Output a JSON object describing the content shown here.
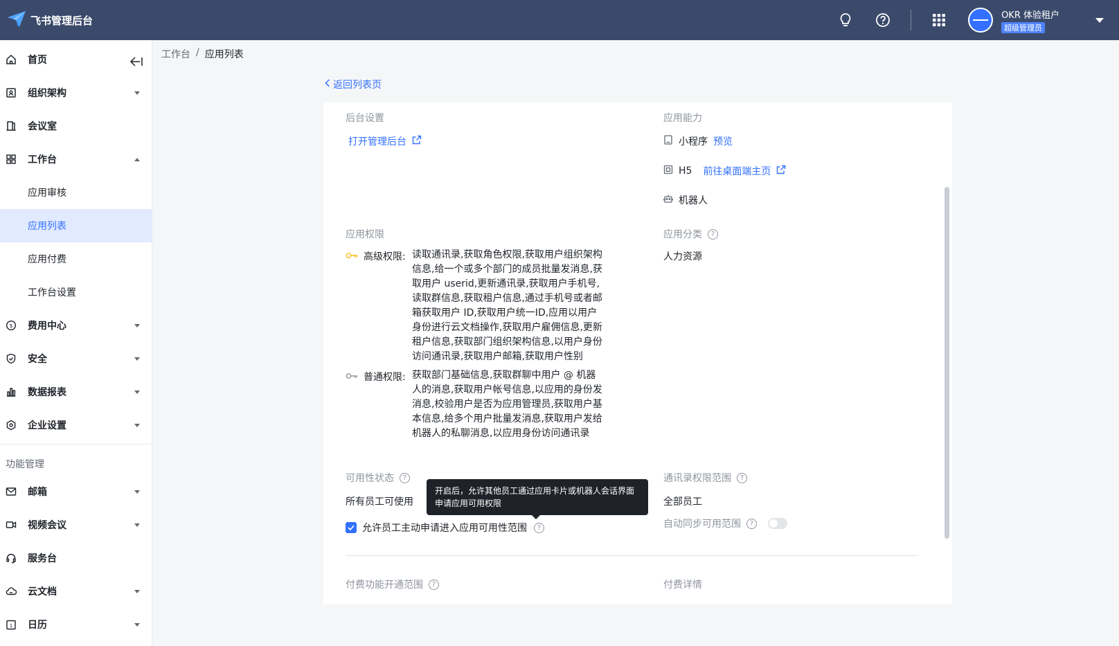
{
  "header": {
    "app_title": "飞书管理后台",
    "tenant_name": "OKR 体验租户",
    "role_badge": "超级管理员",
    "icons": [
      "bulb-icon",
      "help-icon",
      "apps-grid-icon"
    ]
  },
  "sidebar": {
    "items": [
      {
        "label": "首页",
        "icon": "home-icon"
      },
      {
        "label": "组织架构",
        "icon": "org-icon"
      },
      {
        "label": "会议室",
        "icon": "door-icon"
      },
      {
        "label": "工作台",
        "icon": "workbench-icon"
      },
      {
        "label": "费用中心",
        "icon": "coin-icon"
      },
      {
        "label": "安全",
        "icon": "shield-icon"
      },
      {
        "label": "数据报表",
        "icon": "chart-icon"
      },
      {
        "label": "企业设置",
        "icon": "settings-icon"
      },
      {
        "label": "邮箱",
        "icon": "mail-icon"
      },
      {
        "label": "视频会议",
        "icon": "video-icon"
      },
      {
        "label": "服务台",
        "icon": "headset-icon"
      },
      {
        "label": "云文档",
        "icon": "cloud-doc-icon"
      },
      {
        "label": "日历",
        "icon": "calendar-icon"
      }
    ],
    "sub_items": [
      {
        "label": "应用审核"
      },
      {
        "label": "应用列表",
        "active": true
      },
      {
        "label": "应用付费"
      },
      {
        "label": "工作台设置"
      }
    ],
    "group_label": "功能管理"
  },
  "breadcrumb": {
    "root": "工作台",
    "sep": "/",
    "current": "应用列表"
  },
  "back_link": "返回列表页",
  "backend": {
    "title": "后台设置",
    "open_link": "打开管理后台"
  },
  "capability": {
    "title": "应用能力",
    "mini_program": "小程序",
    "preview": "预览",
    "h5": "H5",
    "desktop_link": "前往桌面端主页",
    "bot": "机器人"
  },
  "permissions": {
    "title": "应用权限",
    "high_label": "高级权限:",
    "high_text": "读取通讯录,获取角色权限,获取用户组织架构信息,给一个或多个部门的成员批量发消息,获取用户 userid,更新通讯录,获取用户手机号,读取群信息,获取租户信息,通过手机号或者邮箱获取用户 ID,获取用户统一ID,应用以用户身份进行云文档操作,获取用户雇佣信息,更新租户信息,获取部门组织架构信息,以用户身份访问通讯录,获取用户邮箱,获取用户性别",
    "normal_label": "普通权限:",
    "normal_text": "获取部门基础信息,获取群聊中用户 @ 机器人的消息,获取用户帐号信息,以应用的身份发消息,校验用户是否为应用管理员,获取用户基本信息,给多个用户批量发消息,获取用户发给机器人的私聊消息,以应用身份访问通讯录"
  },
  "category": {
    "title": "应用分类",
    "value": "人力资源"
  },
  "availability": {
    "title": "可用性状态",
    "value": "所有员工可使用",
    "checkbox_label": "允许员工主动申请进入应用可用性范围",
    "tooltip": "开启后，允许其他员工通过应用卡片或机器人会话界面申请应用可用权限"
  },
  "contacts_scope": {
    "title": "通讯录权限范围",
    "value": "全部员工",
    "sync_label": "自动同步可用范围"
  },
  "paid_scope": {
    "title": "付费功能开通范围"
  },
  "paid_detail": {
    "title": "付费详情"
  },
  "colors": {
    "topbar": "#3b4a6b",
    "accent": "#3370ff",
    "active_bg": "#e1eaff"
  }
}
